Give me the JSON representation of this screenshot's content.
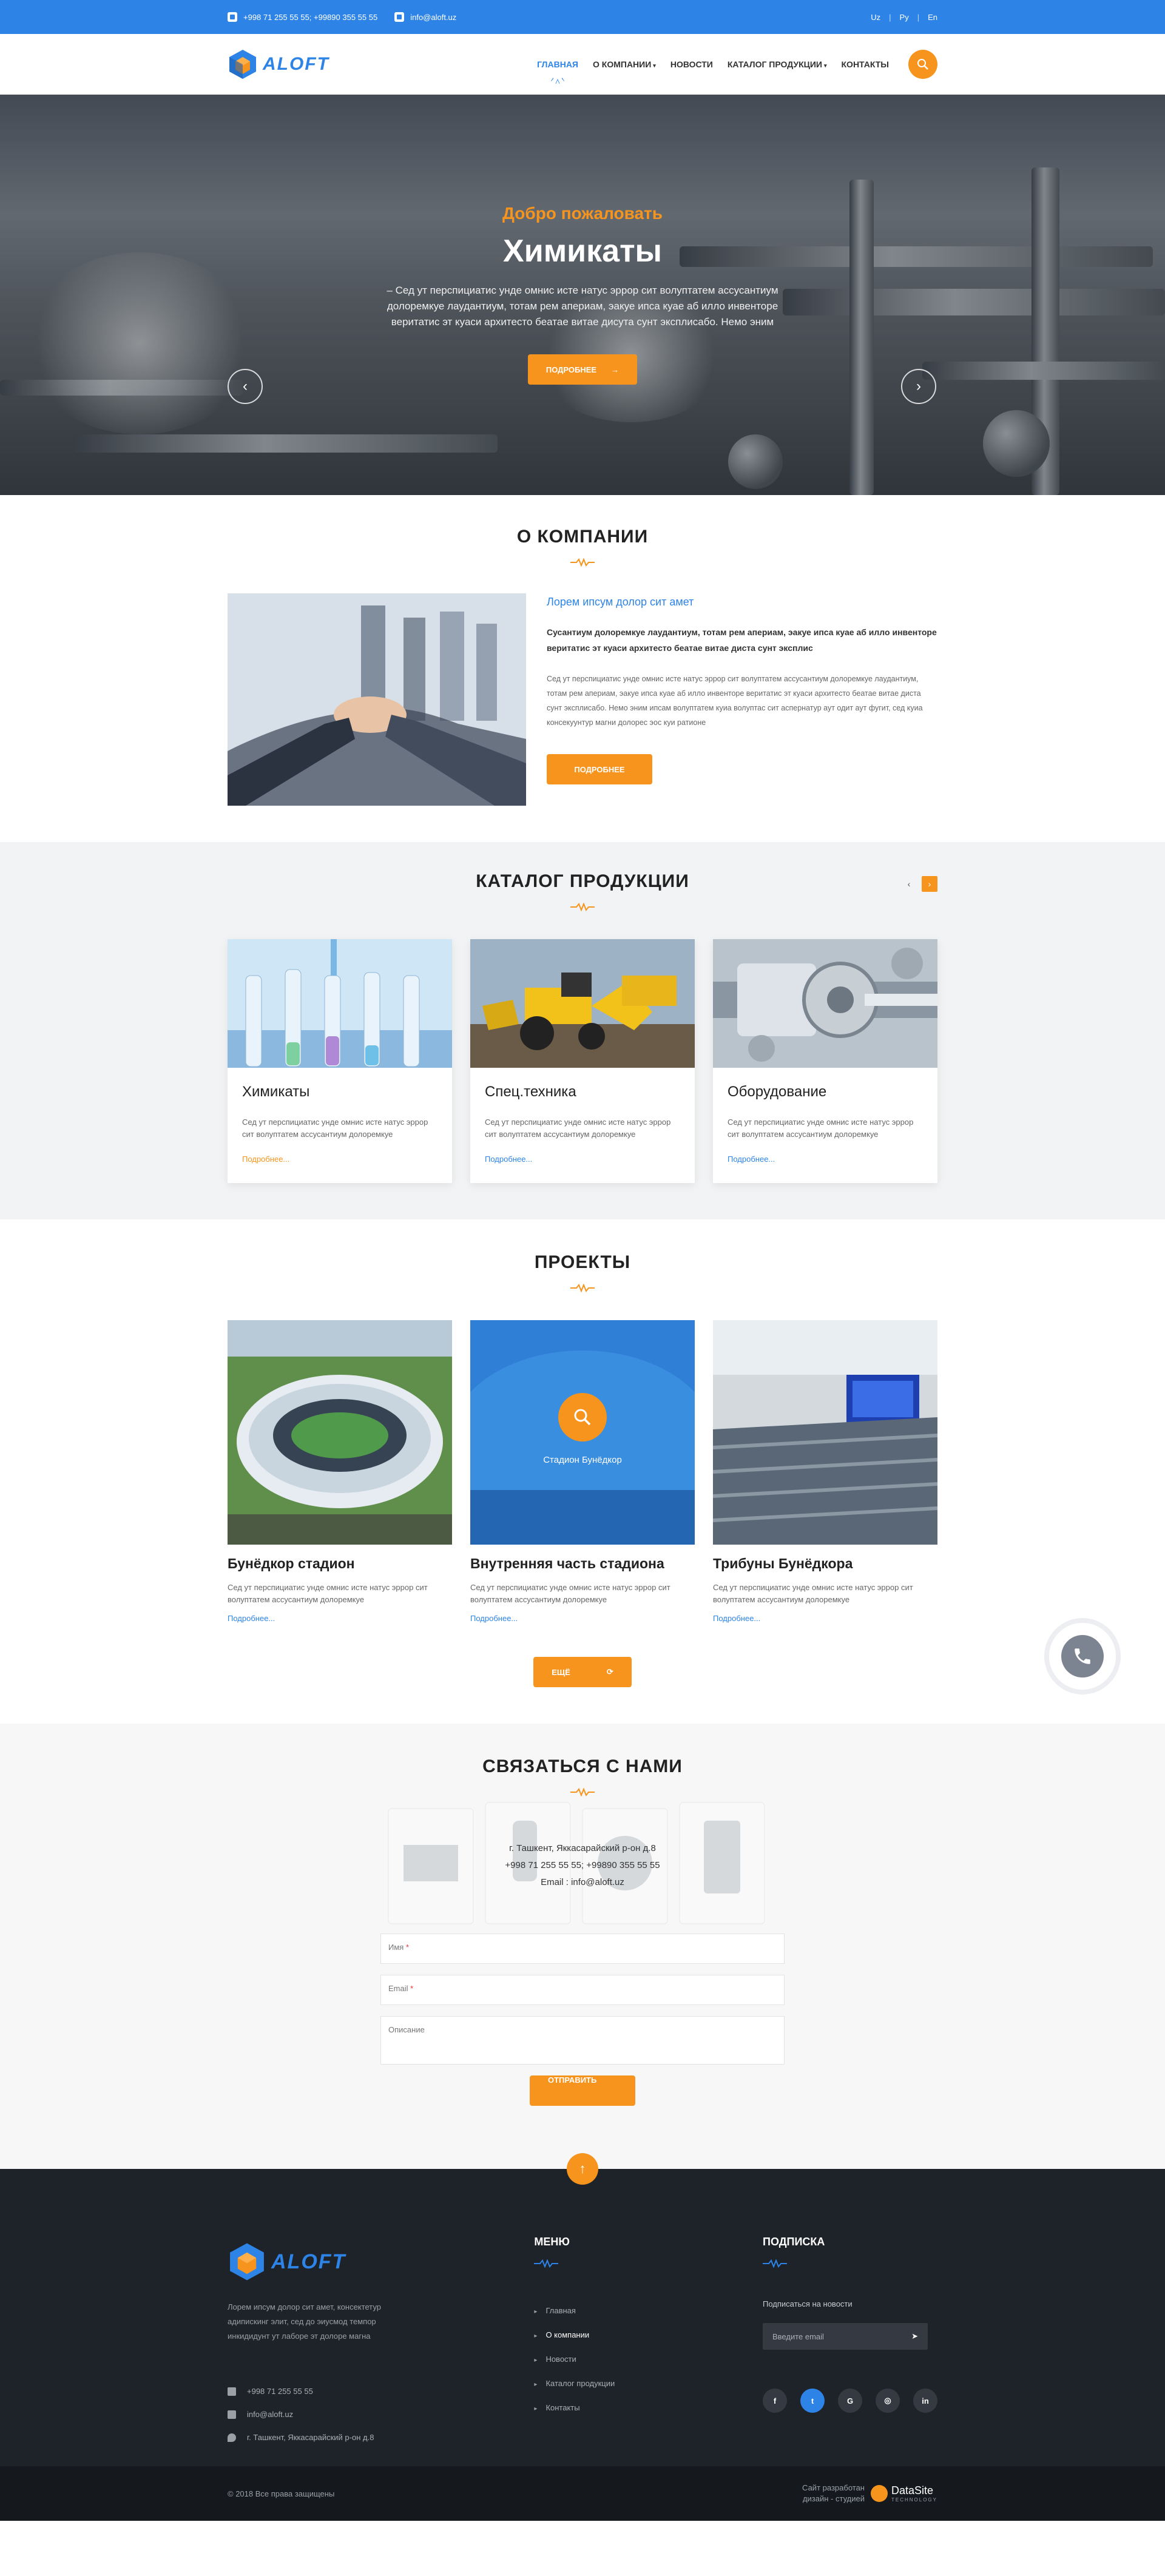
{
  "topbar": {
    "phones": "+998 71 255 55 55; +99890 355 55 55",
    "email": "info@aloft.uz",
    "languages": [
      "Uz",
      "Ру",
      "En"
    ]
  },
  "brand": {
    "logo_text": "ALOFT"
  },
  "nav": {
    "items": [
      {
        "label": "Главная",
        "active": true,
        "dropdown": false
      },
      {
        "label": "О компании",
        "active": false,
        "dropdown": true
      },
      {
        "label": "Новости",
        "active": false,
        "dropdown": false
      },
      {
        "label": "Каталог продукции",
        "active": false,
        "dropdown": true
      },
      {
        "label": "Контакты",
        "active": false,
        "dropdown": false
      }
    ],
    "search_icon": "search-icon"
  },
  "hero": {
    "subtitle": "Добро пожаловать",
    "title": "Химикаты",
    "text": "– Сед ут перспициатис унде омнис исте натус эррор сит волуптатем ассусантиум долоремкуе лаудантиум, тотам рем апериам, эакуе ипса куае аб илло инвенторе веритатис эт куаси архитесто беатае витае дисута сунт эксплисабо. Немо эним",
    "button": "Подробнее"
  },
  "about": {
    "title": "О компании",
    "heading": "Лорем ипсум долор сит амет",
    "bold": "Сусантиум долоремкуе лаудантиум, тотам рем апериам, эакуе ипса куае аб илло инвенторе веритатис эт куаси архитесто беатае витае диста сунт эксплис",
    "text": "Сед ут перспициатис унде омнис исте натус эррор сит волуптатем ассусантиум долоремкуе лаудантиум, тотам рем апериам, эакуе ипса куае аб илло инвенторе веритатис эт куаси архитесто беатае витае диста сунт эксплисабо. Немо эним ипсам волуптатем куиа волуптас сит аспернатур аут одит аут фугит, сед куиа консекуунтур магни долорес эос куи ратионе",
    "button": "Подробнее"
  },
  "catalog": {
    "title": "Каталог продукции",
    "cards": [
      {
        "title": "Химикаты",
        "text": "Сед ут перспициатис унде омнис исте натус эррор сит волуптатем ассусантиум долоремкуе",
        "more": "Подробнее..."
      },
      {
        "title": "Спец.техника",
        "text": "Сед ут перспициатис унде омнис исте натус эррор сит волуптатем ассусантиум долоремкуе",
        "more": "Подробнее..."
      },
      {
        "title": "Оборудование",
        "text": "Сед ут перспициатис унде омнис исте натус эррор сит волуптатем ассусантиум долоремкуе",
        "more": "Подробнее..."
      }
    ]
  },
  "projects": {
    "title": "Проекты",
    "items": [
      {
        "title": "Бунёдкор стадион",
        "text": "Сед ут перспициатис унде омнис исте натус эррор сит волуптатем ассусантиум долоремкуе",
        "more": "Подробнее..."
      },
      {
        "title": "Внутренняя часть стадиона",
        "text": "Сед ут перспициатис унде омнис исте натус эррор сит волуптатем ассусантиум долоремкуе",
        "more": "Подробнее...",
        "overlay": "Стадион Бунёдкор"
      },
      {
        "title": "Трибуны Бунёдкора",
        "text": "Сед ут перспициатис унде омнис исте натус эррор сит волуптатем ассусантиум долоремкуе",
        "more": "Подробнее..."
      }
    ],
    "button": "Ещё"
  },
  "contact": {
    "title": "Связаться с нами",
    "address": "г. Ташкент, Яккасарайский р-он д.8",
    "phones": "+998 71 255 55 55; +99890 355 55 55",
    "email": "Email : info@aloft.uz",
    "fields": {
      "name": "Имя",
      "email": "Email",
      "description": "Описание"
    },
    "button": "Отправить"
  },
  "footer": {
    "desc": "Лорем ипсум долор сит амет, консектетур адипискинг элит, сед до эиусмод темпор инкидидунт ут лаборе эт долоре магна",
    "phone": "+998 71 255 55 55",
    "email": "info@aloft.uz",
    "address": "г. Ташкент, Яккасарайский р-он д.8",
    "menu_title": "Меню",
    "menu": [
      {
        "label": "Главная",
        "current": false
      },
      {
        "label": "О компании",
        "current": true
      },
      {
        "label": "Новости",
        "current": false
      },
      {
        "label": "Каталог продукции",
        "current": false
      },
      {
        "label": "Контакты",
        "current": false
      }
    ],
    "subscribe_title": "Подписка",
    "subscribe_label": "Подписаться на новости",
    "subscribe_placeholder": "Введите email",
    "socials": [
      "f",
      "t",
      "G",
      "◎",
      "in"
    ],
    "copyright": "© 2018 Все права защищены",
    "dev_line1": "Сайт разработан",
    "dev_line2": "дизайн - студией",
    "dev_name": "DataSite",
    "dev_sub": "TECHNOLOGY"
  },
  "colors": {
    "accent": "#f7941d",
    "brand": "#2d84e6",
    "footer": "#1e2229"
  }
}
